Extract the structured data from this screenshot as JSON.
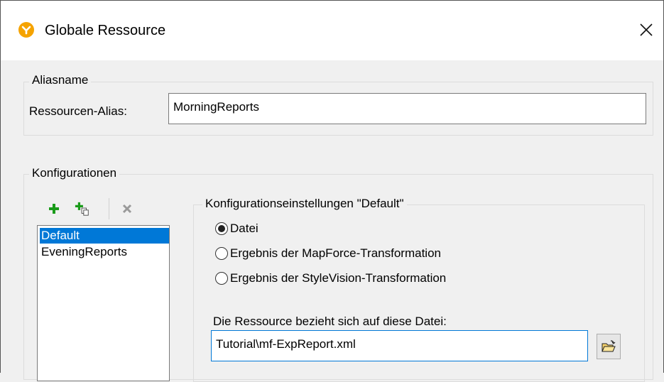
{
  "window": {
    "title": "Globale Ressource",
    "app_icon": "altova-logo-icon",
    "close_icon": "close-icon"
  },
  "alias_group": {
    "legend": "Aliasname",
    "field_label": "Ressourcen-Alias:",
    "field_value": "MorningReports"
  },
  "config_group": {
    "legend": "Konfigurationen",
    "toolbar": [
      {
        "icon": "add-icon",
        "color": "#1a9b1a"
      },
      {
        "icon": "add-copy-icon",
        "color": "#1a9b1a"
      },
      {
        "icon": "delete-icon",
        "color": "#9a9a9a"
      }
    ],
    "items": [
      {
        "label": "Default",
        "selected": true
      },
      {
        "label": "EveningReports",
        "selected": false
      }
    ]
  },
  "settings": {
    "legend": "Konfigurationseinstellungen \"Default\"",
    "options": [
      {
        "label": "Datei",
        "checked": true
      },
      {
        "label": "Ergebnis der MapForce-Transformation",
        "checked": false
      },
      {
        "label": "Ergebnis der StyleVision-Transformation",
        "checked": false
      }
    ],
    "file_label": "Die Ressource bezieht sich auf diese Datei:",
    "file_value": "Tutorial\\mf-ExpReport.xml",
    "browse_icon": "open-folder-icon"
  },
  "colors": {
    "accent": "#0078d7",
    "app_icon": "#f5a300"
  }
}
